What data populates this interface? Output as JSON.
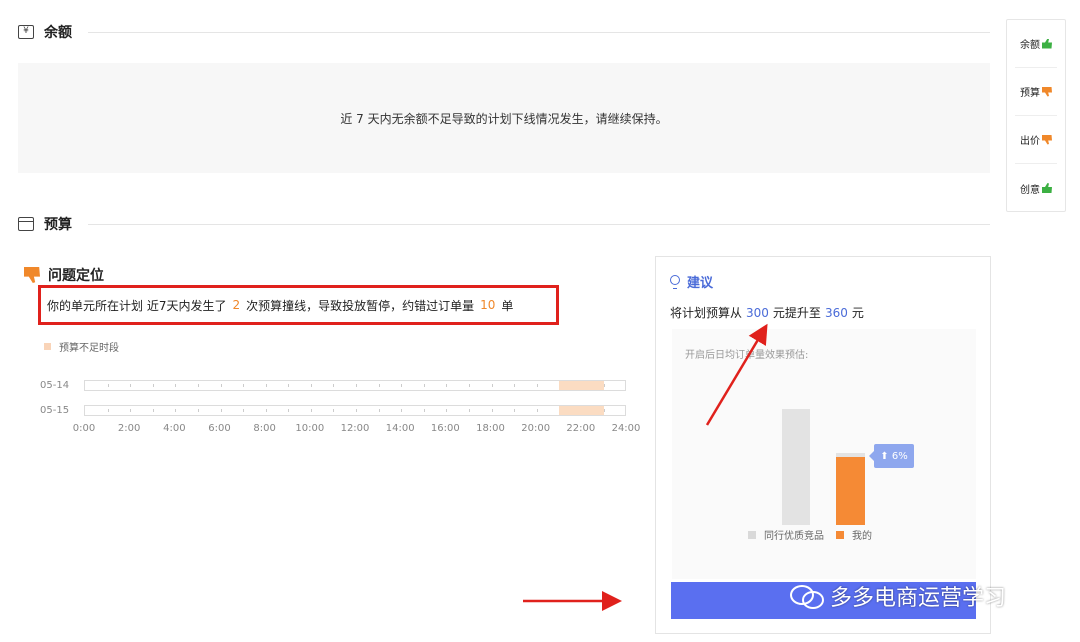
{
  "balance": {
    "icon": "yen-icon",
    "title": "余额",
    "message": "近 7 天内无余额不足导致的计划下线情况发生，请继续保持。"
  },
  "budget": {
    "icon": "wallet-icon",
    "title": "预算"
  },
  "side_nav": {
    "items": [
      {
        "label": "余额",
        "status": "thumbs-up-icon"
      },
      {
        "label": "预算",
        "status": "thumbs-down-icon"
      },
      {
        "label": "出价",
        "status": "thumbs-down-icon"
      },
      {
        "label": "创意",
        "status": "thumbs-up-icon"
      }
    ]
  },
  "problem": {
    "title": "问题定位",
    "text_a": "你的单元所在计划 近7天内发生了",
    "count": "2",
    "text_b": "次预算撞线，导致投放暂停，约错过订单量",
    "missed": "10",
    "text_c": "单"
  },
  "timeline": {
    "legend": "预算不足时段",
    "rows": [
      {
        "date": "05-14",
        "shortage_start_hour": 21,
        "shortage_end_hour": 23
      },
      {
        "date": "05-15",
        "shortage_start_hour": 21,
        "shortage_end_hour": 23
      }
    ],
    "axis": [
      "0:00",
      "2:00",
      "4:00",
      "6:00",
      "8:00",
      "10:00",
      "12:00",
      "14:00",
      "16:00",
      "18:00",
      "20:00",
      "22:00",
      "24:00"
    ]
  },
  "suggestion": {
    "title": "建议",
    "text_a": "将计划预算从",
    "from": "300",
    "text_b": "元提升至",
    "to": "360",
    "text_c": "元",
    "estimate_title": "开启后日均订单量效果预估:",
    "uplift": "6%",
    "legend_peer": "同行优质竞品",
    "legend_mine": "我的"
  },
  "watermark": "多多电商运营学习",
  "colors": {
    "accent_blue": "#4a6bd8",
    "orange": "#f58a35",
    "highlight_red": "#e0211c",
    "cta_blue": "#5a6ff0"
  }
}
